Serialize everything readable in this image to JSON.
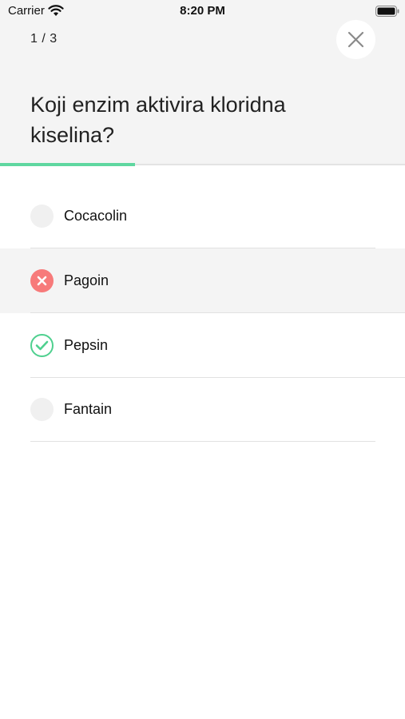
{
  "status_bar": {
    "carrier": "Carrier",
    "time": "8:20 PM"
  },
  "quiz": {
    "counter": "1 / 3",
    "question": "Koji enzim aktivira kloridna kiselina?",
    "progress": 0.333
  },
  "answers": [
    {
      "label": "Cocacolin",
      "state": "neutral"
    },
    {
      "label": "Pagoin",
      "state": "wrong"
    },
    {
      "label": "Pepsin",
      "state": "correct"
    },
    {
      "label": "Fantain",
      "state": "neutral"
    }
  ],
  "colors": {
    "accent": "#5fd7a0",
    "wrong": "#f77a7a",
    "correct": "#4fd08f",
    "header_bg": "#f4f4f4"
  },
  "icons": {
    "close": "close-icon",
    "wrong_mark": "x-mark-icon",
    "correct_mark": "check-mark-icon"
  }
}
